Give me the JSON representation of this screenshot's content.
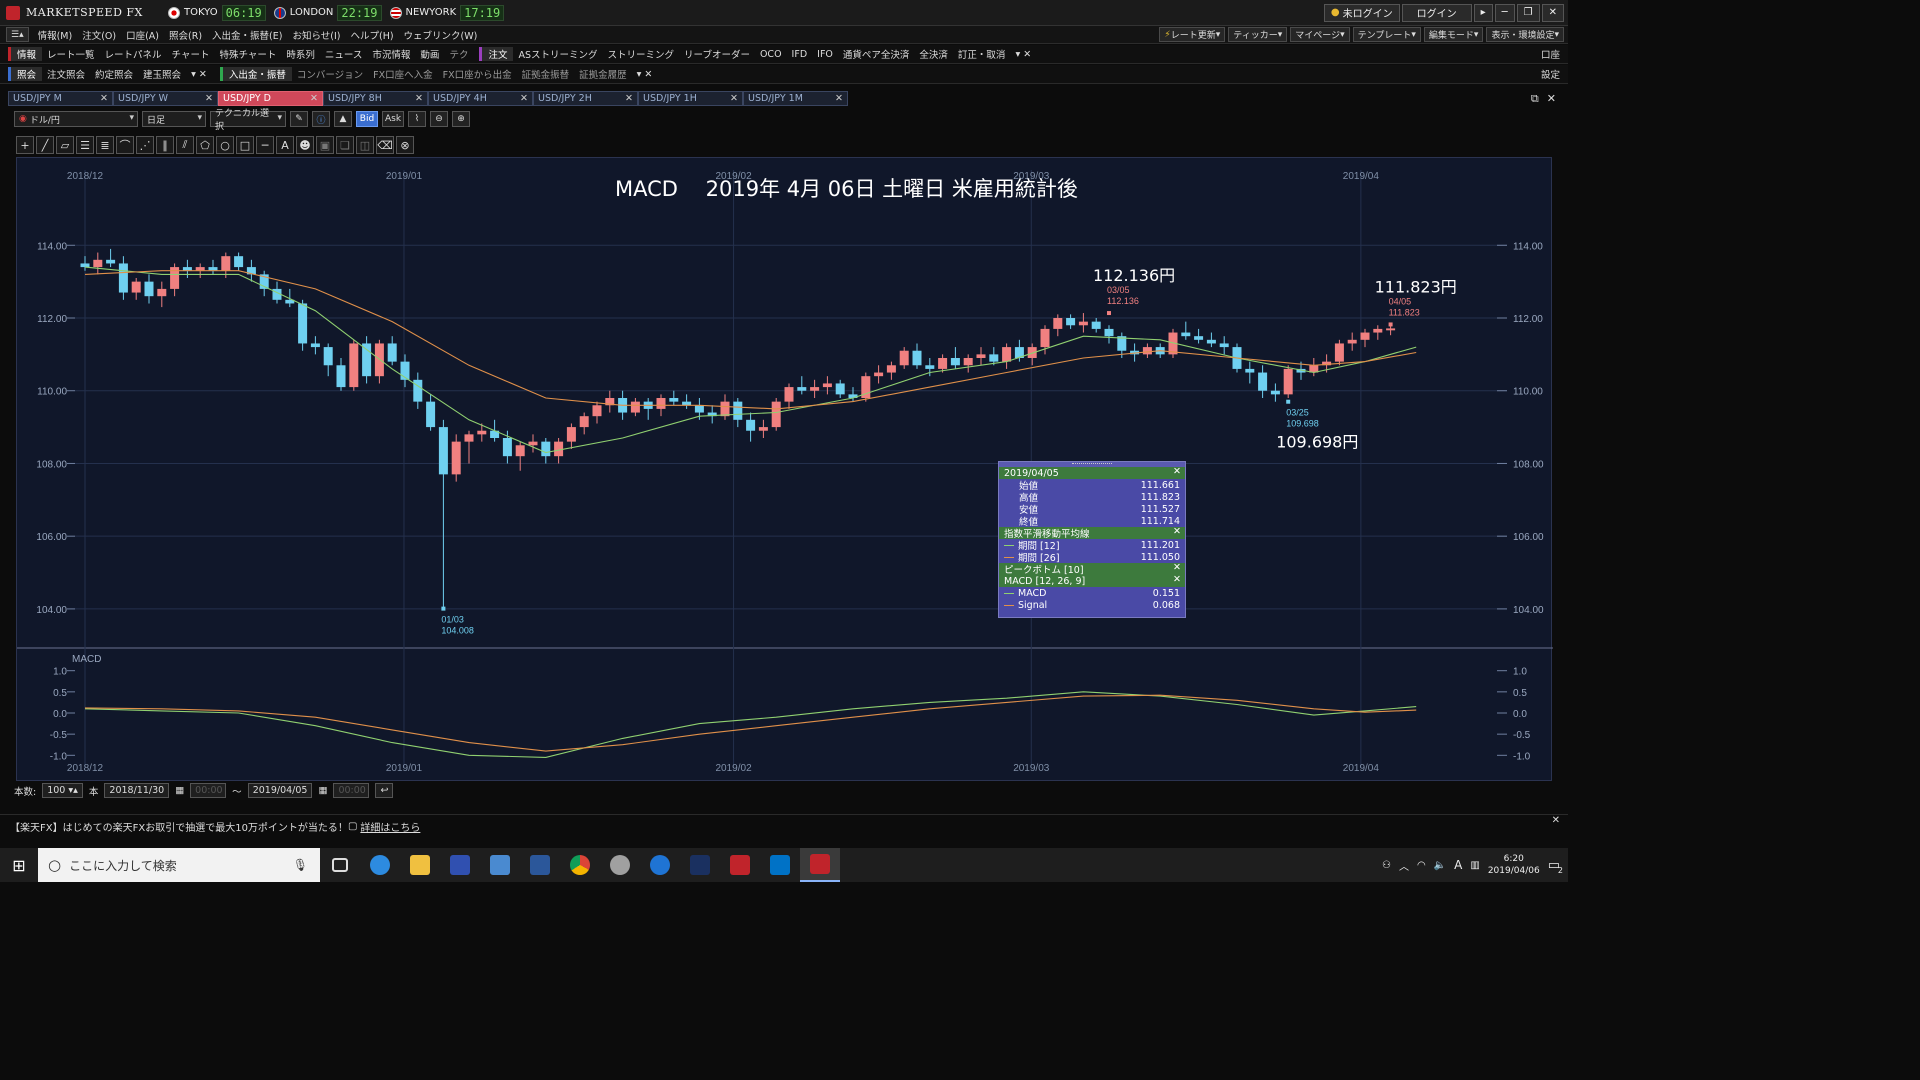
{
  "app": {
    "name": "MARKETSPEED FX"
  },
  "clocks": [
    {
      "city": "TOKYO",
      "time": "06:19"
    },
    {
      "city": "LONDON",
      "time": "22:19"
    },
    {
      "city": "NEWYORK",
      "time": "17:19"
    }
  ],
  "window_buttons": {
    "login_status": "未ログイン",
    "login": "ログイン"
  },
  "menu": [
    "情報(M)",
    "注文(O)",
    "口座(A)",
    "照会(R)",
    "入出金・振替(E)",
    "お知らせ(I)",
    "ヘルプ(H)",
    "ウェブリンク(W)"
  ],
  "menu_right": [
    "レート更新",
    "ティッカー",
    "マイページ",
    "テンプレート",
    "編集モード",
    "表示・環境設定"
  ],
  "toolbar1": {
    "section1": "情報",
    "items1": [
      "レート一覧",
      "レートパネル",
      "チャート",
      "特殊チャート",
      "時系列",
      "ニュース",
      "市況情報",
      "動画",
      "テク"
    ],
    "section2": "注文",
    "items2": [
      "ASストリーミング",
      "ストリーミング",
      "リーブオーダー",
      "OCO",
      "IFD",
      "IFO",
      "通貨ペア全決済",
      "全決済",
      "訂正・取消"
    ],
    "right": "口座"
  },
  "toolbar2": {
    "section1": "照会",
    "items1": [
      "注文照会",
      "約定照会",
      "建玉照会"
    ],
    "section2": "入出金・振替",
    "items2": [
      "コンバージョン",
      "FX口座へ入金",
      "FX口座から出金",
      "証拠金振替",
      "証拠金履歴"
    ],
    "right": "設定"
  },
  "tabs": [
    {
      "label": "USD/JPY M",
      "active": false
    },
    {
      "label": "USD/JPY W",
      "active": false
    },
    {
      "label": "USD/JPY D",
      "active": true
    },
    {
      "label": "USD/JPY 8H",
      "active": false
    },
    {
      "label": "USD/JPY 4H",
      "active": false
    },
    {
      "label": "USD/JPY 2H",
      "active": false
    },
    {
      "label": "USD/JPY 1H",
      "active": false
    },
    {
      "label": "USD/JPY 1M",
      "active": false
    }
  ],
  "controls": {
    "pair": "ドル/円",
    "period": "日足",
    "technical": "テクニカル選択",
    "bid": "Bid",
    "ask": "Ask"
  },
  "chart": {
    "title": "MACD　 2019年 4月 06日 土曜日 米雇用統計後",
    "macd_label": "MACD",
    "annotations": [
      {
        "big": "112.136円",
        "date": "03/05",
        "value": "112.136"
      },
      {
        "big": "111.823円",
        "date": "04/05",
        "value": "111.823"
      },
      {
        "big": "109.698円",
        "date": "03/25",
        "value": "109.698"
      },
      {
        "big": "",
        "date": "01/03",
        "value": "104.008"
      }
    ]
  },
  "chart_data": {
    "type": "candlestick",
    "x_labels": [
      "2018/12",
      "2019/01",
      "2019/02",
      "2019/03",
      "2019/04"
    ],
    "x_label_days": [
      0,
      30,
      61,
      89,
      120
    ],
    "price_ticks": [
      "114.00",
      "112.00",
      "110.00",
      "108.00",
      "106.00",
      "104.00"
    ],
    "price_range": [
      103.2,
      115.3
    ],
    "ohlc": [
      [
        113.5,
        113.7,
        113.3,
        113.4
      ],
      [
        113.4,
        113.8,
        113.2,
        113.6
      ],
      [
        113.6,
        113.9,
        113.4,
        113.5
      ],
      [
        113.5,
        113.7,
        112.5,
        112.7
      ],
      [
        112.7,
        113.1,
        112.5,
        113.0
      ],
      [
        113.0,
        113.2,
        112.4,
        112.6
      ],
      [
        112.6,
        113.0,
        112.3,
        112.8
      ],
      [
        112.8,
        113.5,
        112.6,
        113.4
      ],
      [
        113.4,
        113.6,
        113.1,
        113.3
      ],
      [
        113.3,
        113.5,
        113.1,
        113.4
      ],
      [
        113.4,
        113.6,
        113.2,
        113.3
      ],
      [
        113.3,
        113.8,
        113.1,
        113.7
      ],
      [
        113.7,
        113.8,
        113.3,
        113.4
      ],
      [
        113.4,
        113.6,
        113.0,
        113.2
      ],
      [
        113.2,
        113.3,
        112.6,
        112.8
      ],
      [
        112.8,
        113.0,
        112.4,
        112.5
      ],
      [
        112.5,
        112.8,
        112.3,
        112.4
      ],
      [
        112.4,
        112.5,
        111.1,
        111.3
      ],
      [
        111.3,
        111.5,
        111.0,
        111.2
      ],
      [
        111.2,
        111.3,
        110.4,
        110.7
      ],
      [
        110.7,
        110.9,
        110.0,
        110.1
      ],
      [
        110.1,
        111.4,
        110.0,
        111.3
      ],
      [
        111.3,
        111.5,
        110.2,
        110.4
      ],
      [
        110.4,
        111.4,
        110.2,
        111.3
      ],
      [
        111.3,
        111.5,
        110.7,
        110.8
      ],
      [
        110.8,
        111.0,
        110.1,
        110.3
      ],
      [
        110.3,
        110.5,
        109.5,
        109.7
      ],
      [
        109.7,
        109.9,
        108.9,
        109.0
      ],
      [
        109.0,
        109.2,
        104.0,
        107.7
      ],
      [
        107.7,
        108.8,
        107.5,
        108.6
      ],
      [
        108.6,
        108.9,
        108.0,
        108.8
      ],
      [
        108.8,
        109.1,
        108.6,
        108.9
      ],
      [
        108.9,
        109.2,
        108.6,
        108.7
      ],
      [
        108.7,
        108.9,
        108.0,
        108.2
      ],
      [
        108.2,
        108.6,
        107.8,
        108.5
      ],
      [
        108.5,
        108.8,
        108.3,
        108.6
      ],
      [
        108.6,
        108.7,
        108.0,
        108.2
      ],
      [
        108.2,
        108.7,
        108.0,
        108.6
      ],
      [
        108.6,
        109.1,
        108.4,
        109.0
      ],
      [
        109.0,
        109.4,
        108.8,
        109.3
      ],
      [
        109.3,
        109.7,
        109.1,
        109.6
      ],
      [
        109.6,
        110.0,
        109.4,
        109.8
      ],
      [
        109.8,
        110.0,
        109.2,
        109.4
      ],
      [
        109.4,
        109.8,
        109.3,
        109.7
      ],
      [
        109.7,
        109.8,
        109.2,
        109.5
      ],
      [
        109.5,
        109.9,
        109.3,
        109.8
      ],
      [
        109.8,
        110.0,
        109.6,
        109.7
      ],
      [
        109.7,
        109.9,
        109.5,
        109.6
      ],
      [
        109.6,
        109.8,
        109.2,
        109.4
      ],
      [
        109.4,
        109.6,
        109.1,
        109.3
      ],
      [
        109.3,
        109.9,
        109.2,
        109.7
      ],
      [
        109.7,
        109.8,
        109.0,
        109.2
      ],
      [
        109.2,
        109.4,
        108.6,
        108.9
      ],
      [
        108.9,
        109.2,
        108.7,
        109.0
      ],
      [
        109.0,
        109.8,
        108.9,
        109.7
      ],
      [
        109.7,
        110.2,
        109.5,
        110.1
      ],
      [
        110.1,
        110.4,
        109.9,
        110.0
      ],
      [
        110.0,
        110.3,
        109.8,
        110.1
      ],
      [
        110.1,
        110.4,
        109.9,
        110.2
      ],
      [
        110.2,
        110.3,
        109.8,
        109.9
      ],
      [
        109.9,
        110.1,
        109.7,
        109.8
      ],
      [
        109.8,
        110.5,
        109.7,
        110.4
      ],
      [
        110.4,
        110.7,
        110.2,
        110.5
      ],
      [
        110.5,
        110.8,
        110.3,
        110.7
      ],
      [
        110.7,
        111.2,
        110.6,
        111.1
      ],
      [
        111.1,
        111.3,
        110.6,
        110.7
      ],
      [
        110.7,
        110.9,
        110.4,
        110.6
      ],
      [
        110.6,
        111.0,
        110.5,
        110.9
      ],
      [
        110.9,
        111.2,
        110.6,
        110.7
      ],
      [
        110.7,
        111.0,
        110.5,
        110.9
      ],
      [
        110.9,
        111.2,
        110.7,
        111.0
      ],
      [
        111.0,
        111.2,
        110.7,
        110.8
      ],
      [
        110.8,
        111.3,
        110.6,
        111.2
      ],
      [
        111.2,
        111.4,
        110.8,
        110.9
      ],
      [
        110.9,
        111.3,
        110.7,
        111.2
      ],
      [
        111.2,
        111.8,
        111.0,
        111.7
      ],
      [
        111.7,
        112.1,
        111.5,
        112.0
      ],
      [
        112.0,
        112.1,
        111.7,
        111.8
      ],
      [
        111.8,
        112.136,
        111.6,
        111.9
      ],
      [
        111.9,
        112.0,
        111.6,
        111.7
      ],
      [
        111.7,
        111.8,
        111.3,
        111.5
      ],
      [
        111.5,
        111.6,
        110.9,
        111.1
      ],
      [
        111.1,
        111.3,
        110.8,
        111.0
      ],
      [
        111.0,
        111.3,
        110.9,
        111.2
      ],
      [
        111.2,
        111.3,
        110.9,
        111.0
      ],
      [
        111.0,
        111.7,
        110.9,
        111.6
      ],
      [
        111.6,
        111.9,
        111.4,
        111.5
      ],
      [
        111.5,
        111.7,
        111.3,
        111.4
      ],
      [
        111.4,
        111.6,
        111.2,
        111.3
      ],
      [
        111.3,
        111.5,
        111.0,
        111.2
      ],
      [
        111.2,
        111.3,
        110.5,
        110.6
      ],
      [
        110.6,
        110.8,
        110.2,
        110.5
      ],
      [
        110.5,
        110.7,
        109.8,
        110.0
      ],
      [
        110.0,
        110.2,
        109.698,
        109.9
      ],
      [
        109.9,
        110.7,
        109.8,
        110.6
      ],
      [
        110.6,
        110.8,
        110.3,
        110.5
      ],
      [
        110.5,
        110.9,
        110.4,
        110.7
      ],
      [
        110.7,
        111.0,
        110.5,
        110.8
      ],
      [
        110.8,
        111.4,
        110.7,
        111.3
      ],
      [
        111.3,
        111.6,
        111.1,
        111.4
      ],
      [
        111.4,
        111.7,
        111.2,
        111.6
      ],
      [
        111.6,
        111.8,
        111.4,
        111.7
      ],
      [
        111.661,
        111.823,
        111.527,
        111.714
      ]
    ],
    "ema12": [
      [
        0,
        113.4
      ],
      [
        6,
        113.2
      ],
      [
        12,
        113.2
      ],
      [
        18,
        112.2
      ],
      [
        24,
        110.6
      ],
      [
        30,
        109.2
      ],
      [
        36,
        108.3
      ],
      [
        42,
        108.7
      ],
      [
        48,
        109.3
      ],
      [
        54,
        109.4
      ],
      [
        60,
        109.8
      ],
      [
        66,
        110.5
      ],
      [
        72,
        110.8
      ],
      [
        78,
        111.5
      ],
      [
        84,
        111.4
      ],
      [
        90,
        110.9
      ],
      [
        96,
        110.5
      ],
      [
        100,
        110.8
      ],
      [
        104,
        111.201
      ]
    ],
    "ema26": [
      [
        0,
        113.2
      ],
      [
        6,
        113.3
      ],
      [
        12,
        113.3
      ],
      [
        18,
        112.8
      ],
      [
        24,
        111.9
      ],
      [
        30,
        110.7
      ],
      [
        36,
        109.8
      ],
      [
        42,
        109.6
      ],
      [
        48,
        109.6
      ],
      [
        54,
        109.5
      ],
      [
        60,
        109.7
      ],
      [
        66,
        110.1
      ],
      [
        72,
        110.5
      ],
      [
        78,
        110.9
      ],
      [
        84,
        111.1
      ],
      [
        90,
        110.9
      ],
      [
        96,
        110.7
      ],
      [
        100,
        110.8
      ],
      [
        104,
        111.05
      ]
    ],
    "macd_ticks": [
      "1.0",
      "0.5",
      "0.0",
      "-0.5",
      "-1.0"
    ],
    "macd_range": [
      -1.3,
      1.3
    ],
    "macd": [
      [
        0,
        0.1
      ],
      [
        6,
        0.05
      ],
      [
        12,
        0.0
      ],
      [
        18,
        -0.3
      ],
      [
        24,
        -0.7
      ],
      [
        30,
        -1.0
      ],
      [
        36,
        -1.05
      ],
      [
        42,
        -0.6
      ],
      [
        48,
        -0.25
      ],
      [
        54,
        -0.1
      ],
      [
        60,
        0.1
      ],
      [
        66,
        0.25
      ],
      [
        72,
        0.35
      ],
      [
        78,
        0.5
      ],
      [
        84,
        0.4
      ],
      [
        90,
        0.2
      ],
      [
        96,
        -0.05
      ],
      [
        100,
        0.05
      ],
      [
        104,
        0.151
      ]
    ],
    "signal": [
      [
        0,
        0.12
      ],
      [
        6,
        0.1
      ],
      [
        12,
        0.05
      ],
      [
        18,
        -0.1
      ],
      [
        24,
        -0.4
      ],
      [
        30,
        -0.7
      ],
      [
        36,
        -0.9
      ],
      [
        42,
        -0.75
      ],
      [
        48,
        -0.5
      ],
      [
        54,
        -0.3
      ],
      [
        60,
        -0.1
      ],
      [
        66,
        0.1
      ],
      [
        72,
        0.25
      ],
      [
        78,
        0.4
      ],
      [
        84,
        0.42
      ],
      [
        90,
        0.3
      ],
      [
        96,
        0.1
      ],
      [
        100,
        0.02
      ],
      [
        104,
        0.068
      ]
    ]
  },
  "infobox": {
    "date": "2019/04/05",
    "open_label": "始値",
    "open": "111.661",
    "high_label": "高値",
    "high": "111.823",
    "low_label": "安値",
    "low": "111.527",
    "close_label": "終値",
    "close": "111.714",
    "ema_title": "指数平滑移動平均線",
    "ema12_label": "期間 [12]",
    "ema12": "111.201",
    "ema26_label": "期間 [26]",
    "ema26": "111.050",
    "peak_title": "ピークボトム [10]",
    "macd_title": "MACD [12, 26, 9]",
    "macd_label": "MACD",
    "macd": "0.151",
    "signal_label": "Signal",
    "signal": "0.068"
  },
  "footer": {
    "count_label": "本数:",
    "count": "100",
    "unit": "本",
    "from": "2018/11/30",
    "tilde": "〜",
    "to": "2019/04/05",
    "time": "00:00"
  },
  "news": {
    "text": "【楽天FX】はじめての楽天FXお取引で抽選で最大10万ポイントが当たる！",
    "link": "詳細はこちら"
  },
  "taskbar": {
    "search_placeholder": "ここに入力して検索",
    "time": "6:20",
    "date": "2019/04/06",
    "notify": "2"
  },
  "colors": {
    "up": "#f08080",
    "down": "#6fd0f0",
    "ema12": "#90d070",
    "ema26": "#e0904a",
    "chart_bg": "#10172a",
    "active_tab": "#d0485a"
  }
}
